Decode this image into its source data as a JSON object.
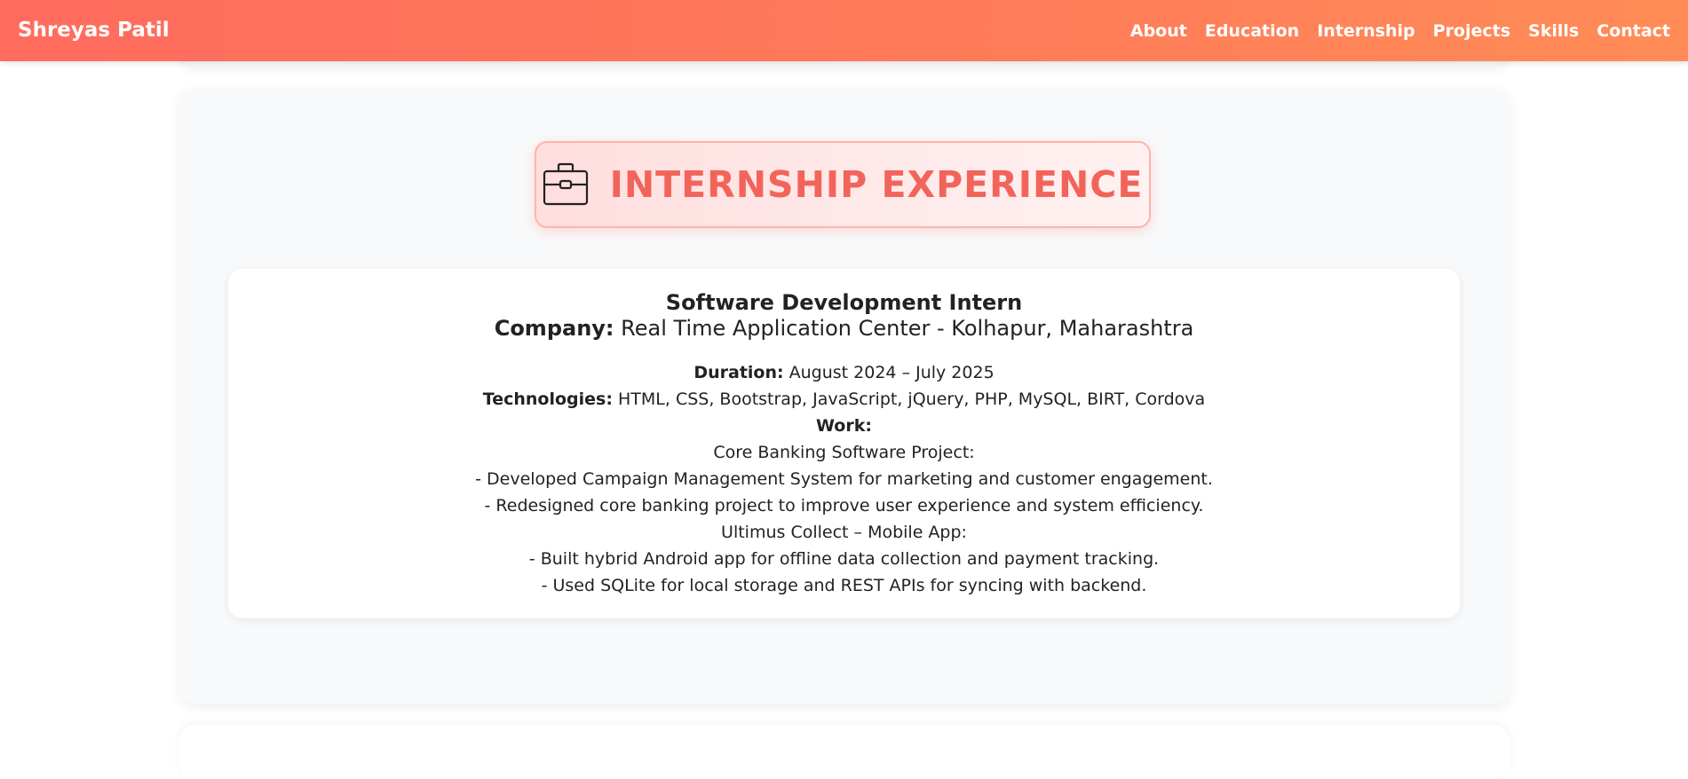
{
  "navbar": {
    "brand": "Shreyas Patil",
    "links": [
      "About",
      "Education",
      "Internship",
      "Projects",
      "Skills",
      "Contact"
    ]
  },
  "section": {
    "icon": "briefcase-icon",
    "title": "INTERNSHIP EXPERIENCE"
  },
  "internship": {
    "role": "Software Development Intern",
    "company_label": "Company:",
    "company": "Real Time Application Center - Kolhapur, Maharashtra",
    "duration_label": "Duration:",
    "duration": "August 2024 – July 2025",
    "technologies_label": "Technologies:",
    "technologies": "HTML, CSS, Bootstrap, JavaScript, jQuery, PHP, MySQL, BIRT, Cordova",
    "work_label": "Work:",
    "work_lines": [
      "Core Banking Software Project:",
      "- Developed Campaign Management System for marketing and customer engagement.",
      "- Redesigned core banking project to improve user experience and system efficiency.",
      "Ultimus Collect – Mobile App:",
      "- Built hybrid Android app for offline data collection and payment tracking.",
      "- Used SQLite for local storage and REST APIs for syncing with backend."
    ]
  },
  "colors": {
    "nav_gradient_start": "#ff6b5e",
    "nav_gradient_end": "#ff8c57",
    "accent": "#f2645a"
  }
}
